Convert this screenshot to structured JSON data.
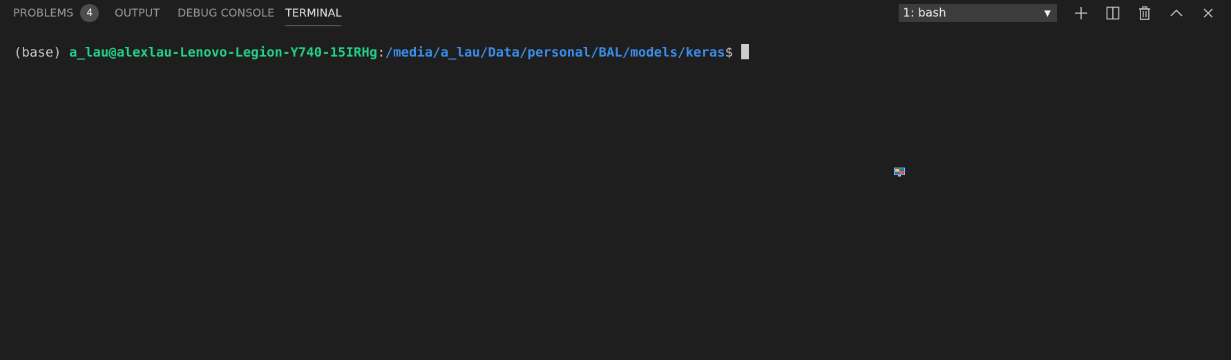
{
  "tabs": {
    "problems": {
      "label": "PROBLEMS",
      "badge": "4"
    },
    "output": {
      "label": "OUTPUT"
    },
    "debug_console": {
      "label": "DEBUG CONSOLE"
    },
    "terminal": {
      "label": "TERMINAL",
      "active": true
    }
  },
  "terminal_select": {
    "value": "1: bash",
    "caret": "▼"
  },
  "actions": [
    {
      "name": "new-terminal",
      "icon": "plus-icon"
    },
    {
      "name": "split-terminal",
      "icon": "split-icon"
    },
    {
      "name": "kill-terminal",
      "icon": "trash-icon"
    },
    {
      "name": "maximize-panel",
      "icon": "chevron-up-icon"
    },
    {
      "name": "close-panel",
      "icon": "close-icon"
    }
  ],
  "terminal": {
    "env": "(base) ",
    "user_host": "a_lau@alexlau-Lenovo-Legion-Y740-15IRHg",
    "colon": ":",
    "path": "/media/a_lau/Data/personal/BAL/models/keras",
    "prompt_symbol": "$ "
  },
  "colors": {
    "background": "#1e1e1e",
    "host_green": "#23d18b",
    "path_blue": "#3b8eea",
    "text": "#cccccc",
    "inactive_tab": "#9a9a9a"
  }
}
